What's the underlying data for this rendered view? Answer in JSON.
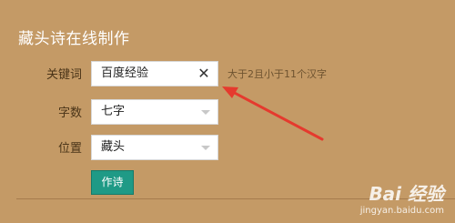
{
  "form": {
    "title": "藏头诗在线制作",
    "keyword_label": "关键词",
    "keyword_value": "百度经验",
    "keyword_hint": "大于2且小于11个汉字",
    "count_label": "字数",
    "count_value": "七字",
    "position_label": "位置",
    "position_value": "藏头",
    "submit_label": "作诗"
  },
  "icons": {
    "clear": "close-icon",
    "dropdown": "chevron-down-icon",
    "annotation": "red-arrow"
  },
  "colors": {
    "page_background": "#c49a66",
    "button": "#1f9a86",
    "annotation_arrow": "#e53a2e"
  },
  "watermark": {
    "main": "Bai 经验",
    "sub": "jingyan.baidu.com"
  }
}
